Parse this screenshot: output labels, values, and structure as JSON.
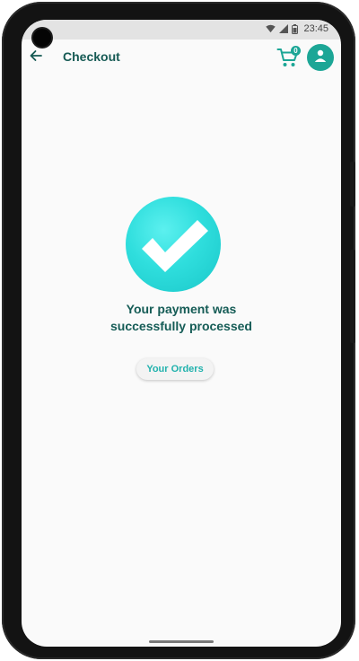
{
  "status_bar": {
    "time": "23:45",
    "icons": [
      "wifi-icon",
      "signal-icon",
      "battery-icon"
    ]
  },
  "app_bar": {
    "back_icon": "arrow-left-icon",
    "title": "Checkout",
    "cart_icon": "shopping-cart-icon",
    "cart_count": "0",
    "profile_icon": "person-icon"
  },
  "main": {
    "success_icon": "check-circle-icon",
    "message_line1": "Your payment was",
    "message_line2": "successfully processed",
    "orders_button_label": "Your Orders"
  },
  "colors": {
    "primary": "#1ca696",
    "title_text": "#165a54",
    "success_circle": "#2fdedd",
    "button_text": "#21b2ad"
  }
}
